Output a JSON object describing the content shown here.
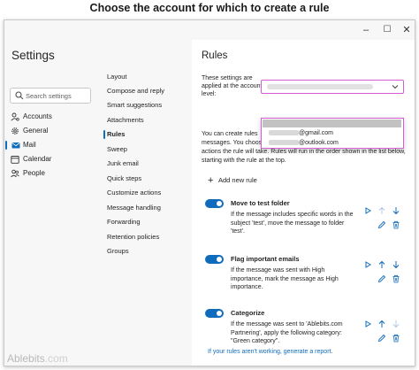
{
  "caption": "Choose the account for which to create a rule",
  "window": {
    "controls": {
      "minimize": "–",
      "maximize": "☐",
      "close": "✕"
    }
  },
  "nav": {
    "title": "Settings",
    "search_placeholder": "Search settings",
    "items": [
      {
        "label": "Accounts",
        "icon": "person-gear-icon",
        "active": false
      },
      {
        "label": "General",
        "icon": "gear-icon",
        "active": false
      },
      {
        "label": "Mail",
        "icon": "mail-icon",
        "active": true
      },
      {
        "label": "Calendar",
        "icon": "calendar-icon",
        "active": false
      },
      {
        "label": "People",
        "icon": "people-icon",
        "active": false
      }
    ]
  },
  "mail_nav": {
    "items": [
      "Layout",
      "Compose and reply",
      "Smart suggestions",
      "Attachments",
      "Rules",
      "Sweep",
      "Junk email",
      "Quick steps",
      "Customize actions",
      "Message handling",
      "Forwarding",
      "Retention policies",
      "Groups"
    ],
    "active": "Rules"
  },
  "panel": {
    "title": "Rules",
    "account_label": "These settings are applied at the account level:",
    "dropdown_options": [
      "@gmail.com",
      "@outlook.com"
    ],
    "desc_line1": "You can create rules",
    "desc_line2": "messages. You choose",
    "desc_line3": "actions the rule will take. Rules will run in the order shown in the list below, starting with the rule at the top.",
    "add_rule_label": "Add new rule",
    "rules": [
      {
        "name": "Move to test folder",
        "description": "If the message includes specific words in the subject 'test', move the message to folder 'test'.",
        "enabled": true
      },
      {
        "name": "Flag important emails",
        "description": "If the message was sent with High importance, mark the message as High importance.",
        "enabled": true
      },
      {
        "name": "Categorize",
        "description": "If the message was sent to 'Ablebits.com Partnering', apply the following category: \"Green category\".",
        "enabled": true
      }
    ],
    "report_prefix": "If your rules aren't working, ",
    "report_link": "generate a report."
  },
  "watermark": {
    "brand": "Ablebits",
    "suffix": ".com"
  },
  "colors": {
    "accent": "#0f6cbd",
    "highlight": "#d35bd3",
    "panel_bg": "#ffffff",
    "nav_bg": "#f7f7f7"
  }
}
